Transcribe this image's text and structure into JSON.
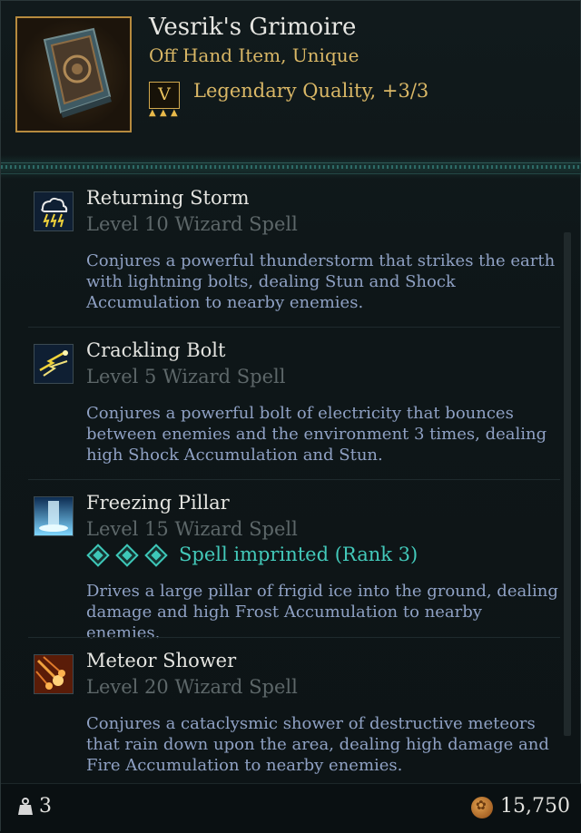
{
  "item": {
    "name": "Vesrik's Grimoire",
    "type": "Off Hand Item, Unique",
    "quality_badge": "V",
    "quality_text": "Legendary Quality, +3/3",
    "icon": "grimoire-book-icon"
  },
  "spells": [
    {
      "name": "Returning Storm",
      "level": "Level 10 Wizard Spell",
      "description": "Conjures a powerful thunderstorm that strikes the earth with lightning bolts, dealing Stun and Shock Accumulation to nearby enemies.",
      "icon": "storm-cloud-icon"
    },
    {
      "name": "Crackling Bolt",
      "level": "Level 5 Wizard Spell",
      "description": "Conjures a powerful bolt of electricity that bounces between enemies and the environment 3 times, dealing high Shock Accumulation and Stun.",
      "icon": "lightning-bolt-icon"
    },
    {
      "name": "Freezing Pillar",
      "level": "Level 15 Wizard Spell",
      "imprint": "Spell imprinted (Rank 3)",
      "imprint_rank": 3,
      "description": "Drives a large pillar of frigid ice into the ground, dealing damage and high Frost Accumulation to nearby enemies.",
      "icon": "ice-pillar-icon"
    },
    {
      "name": "Meteor Shower",
      "level": "Level 20 Wizard Spell",
      "description": "Conjures a cataclysmic shower of destructive meteors that rain down upon the area, dealing high damage and Fire Accumulation to nearby enemies.",
      "icon": "meteor-icon"
    }
  ],
  "footer": {
    "weight": "3",
    "weight_icon": "weight-icon",
    "gold": "15,750",
    "gold_icon": "gold-coin-icon"
  },
  "colors": {
    "legendary": "#d9b766",
    "imprint": "#43c9ba",
    "description": "#8fa1c4",
    "level": "#5d6769"
  }
}
